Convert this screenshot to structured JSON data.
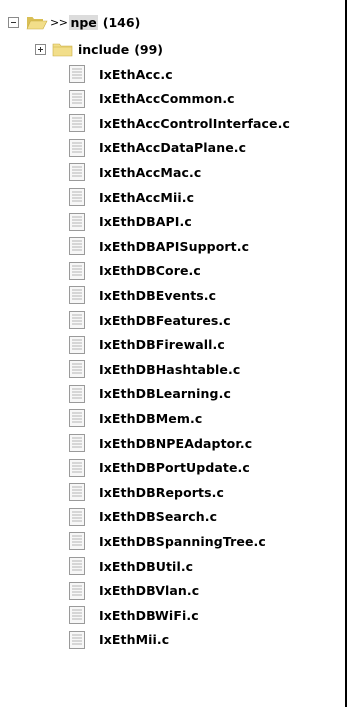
{
  "tree": {
    "root": {
      "toggle": "collapse",
      "icon": "folder-open-icon",
      "arrows": ">>",
      "name": "npe",
      "count": "(146)"
    },
    "subfolder": {
      "toggle": "expand",
      "icon": "folder-icon",
      "name": "include",
      "count": "(99)"
    },
    "files": [
      "IxEthAcc.c",
      "IxEthAccCommon.c",
      "IxEthAccControlInterface.c",
      "IxEthAccDataPlane.c",
      "IxEthAccMac.c",
      "IxEthAccMii.c",
      "IxEthDBAPI.c",
      "IxEthDBAPISupport.c",
      "IxEthDBCore.c",
      "IxEthDBEvents.c",
      "IxEthDBFeatures.c",
      "IxEthDBFirewall.c",
      "IxEthDBHashtable.c",
      "IxEthDBLearning.c",
      "IxEthDBMem.c",
      "IxEthDBNPEAdaptor.c",
      "IxEthDBPortUpdate.c",
      "IxEthDBReports.c",
      "IxEthDBSearch.c",
      "IxEthDBSpanningTree.c",
      "IxEthDBUtil.c",
      "IxEthDBVlan.c",
      "IxEthDBWiFi.c",
      "IxEthMii.c"
    ],
    "file_icon": "text-file-icon",
    "colors": {
      "folder": "#f2de8a",
      "folder_dark": "#d9bf55",
      "selection": "#dcdcdc",
      "text": "#000000"
    }
  }
}
